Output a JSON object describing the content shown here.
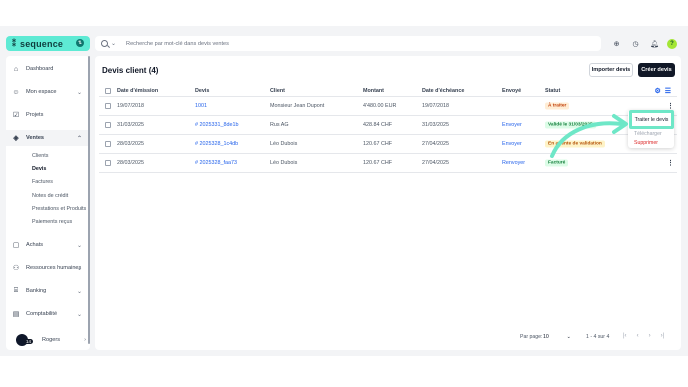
{
  "header": {
    "logo_text": "sequence",
    "search_placeholder": "Recherche par mot-clé dans devis ventes"
  },
  "sidebar": {
    "items": [
      {
        "label": "Dashboard",
        "icon": "home-icon"
      },
      {
        "label": "Mon espace",
        "icon": "user-icon"
      },
      {
        "label": "Projets",
        "icon": "check-square-icon"
      },
      {
        "label": "Ventes",
        "icon": "tag-icon"
      },
      {
        "label": "Achats",
        "icon": "bag-icon"
      },
      {
        "label": "Ressources humaines",
        "icon": "people-icon"
      },
      {
        "label": "Banking",
        "icon": "bank-icon"
      },
      {
        "label": "Comptabilité",
        "icon": "calculator-icon"
      }
    ],
    "sub_items": [
      "Clients",
      "Devis",
      "Factures",
      "Notes de crédit",
      "Prestations et Produits",
      "Paiements reçus"
    ],
    "user_name": "Rogers",
    "user_badge": "14"
  },
  "main": {
    "title": "Devis client (4)",
    "import_label": "Importer devis",
    "create_label": "Créer devis",
    "columns": [
      "Date d'émission",
      "Devis",
      "Client",
      "Montant",
      "Date d'échéance",
      "Envoyé",
      "Statut"
    ],
    "rows": [
      {
        "date": "19/07/2018",
        "devis": "1001",
        "client": "Monsieur Jean Dupont",
        "montant": "4'480.00 EUR",
        "echeance": "19/07/2018",
        "envoye": "",
        "statut": "À traiter",
        "statut_type": "orange"
      },
      {
        "date": "31/03/2025",
        "devis": "# 2025331_8de1b",
        "client": "Rus AG",
        "montant": "428.84 CHF",
        "echeance": "31/03/2025",
        "envoye": "Envoyer",
        "statut": "Validé le 31/03/2025",
        "statut_type": "green"
      },
      {
        "date": "28/03/2025",
        "devis": "# 2025328_1c4db",
        "client": "Léo Dubois",
        "montant": "120.67 CHF",
        "echeance": "27/04/2025",
        "envoye": "Envoyer",
        "statut": "En attente de validation",
        "statut_type": "yellow"
      },
      {
        "date": "28/03/2025",
        "devis": "# 2025328_faa73",
        "client": "Léo Dubois",
        "montant": "120.67 CHF",
        "echeance": "27/04/2025",
        "envoye": "Renvoyer",
        "statut": "Facturé",
        "statut_type": "green"
      }
    ]
  },
  "dropdown": {
    "highlight_label": "Traiter le devis",
    "partial_label": "Télécharger",
    "delete_label": "Supprimer"
  },
  "pagination": {
    "per_page_label": "Par page:",
    "per_page_value": "10",
    "range": "1 - 4 sur 4"
  },
  "colors": {
    "brand": "#5eead4",
    "highlight": "#6ee7c7",
    "link": "#2563eb"
  }
}
